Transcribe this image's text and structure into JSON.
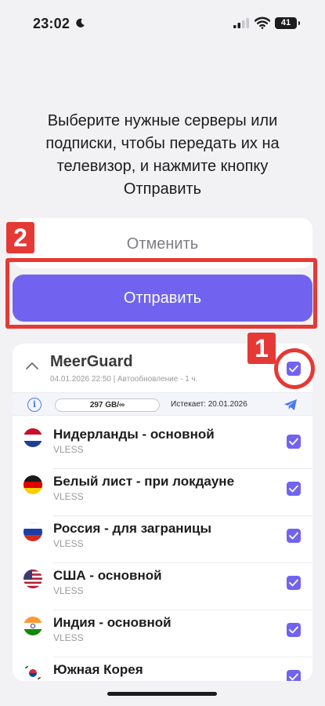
{
  "status_bar": {
    "time": "23:02",
    "battery": "41"
  },
  "instruction_text": "Выберите нужные серверы или подписки, чтобы передать их на телевизор, и нажмите кнопку Отправить",
  "buttons": {
    "cancel": "Отменить",
    "send": "Отправить"
  },
  "annotations": {
    "step_1": "1",
    "step_2": "2",
    "color": "#e53935"
  },
  "accent_color": "#7163f0",
  "subscription": {
    "name": "MeerGuard",
    "meta": "04.01.2026 22:50 | Автообновление - 1 ч.",
    "traffic": "297 GB/∞",
    "expires": "Истекает: 20.01.2026",
    "checked": true
  },
  "servers": [
    {
      "name": "Нидерланды  - основной",
      "protocol": "VLESS",
      "flag": "netherlands-flag-icon",
      "checked": true
    },
    {
      "name": "Белый лист  - при локдауне",
      "protocol": "VLESS",
      "flag": "germany-flag-icon",
      "checked": true
    },
    {
      "name": "Россия  - для заграницы",
      "protocol": "VLESS",
      "flag": "russia-flag-icon",
      "checked": true
    },
    {
      "name": "США  - основной",
      "protocol": "VLESS",
      "flag": "usa-flag-icon",
      "checked": true
    },
    {
      "name": "Индия  - основной",
      "protocol": "VLESS",
      "flag": "india-flag-icon",
      "checked": true
    },
    {
      "name": "Южная Корея",
      "protocol": "",
      "flag": "south-korea-flag-icon",
      "checked": true
    }
  ]
}
